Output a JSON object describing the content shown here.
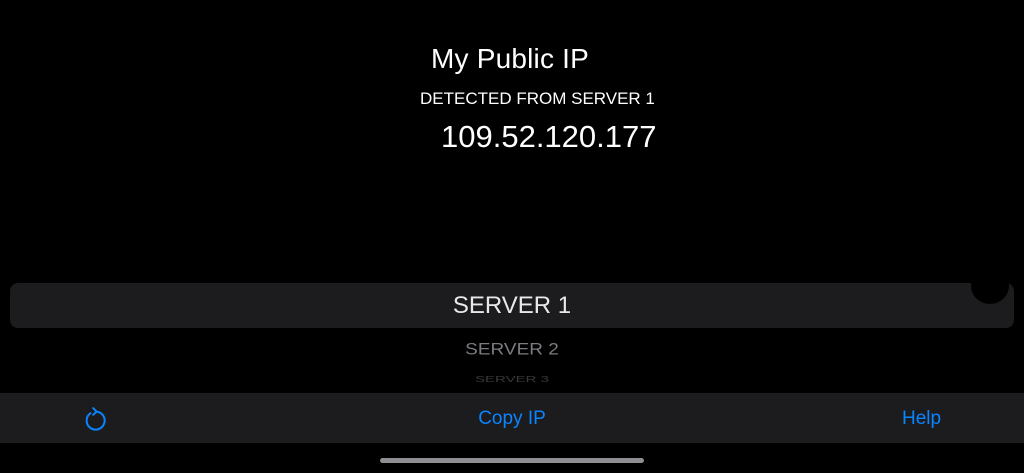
{
  "header": {
    "title": "My Public IP",
    "source_label": "DETECTED FROM SERVER 1",
    "ip_address": "109.52.120.177"
  },
  "server_picker": {
    "selected": "SERVER 1",
    "options": [
      "SERVER 1",
      "SERVER 2",
      "SERVER 3"
    ]
  },
  "toolbar": {
    "refresh_icon": "refresh-icon",
    "copy_label": "Copy IP",
    "help_label": "Help"
  },
  "colors": {
    "background": "#000000",
    "toolbar": "#1c1c1e",
    "picker_highlight": "#1c1c1e",
    "accent": "#0a84ff",
    "text": "#ffffff"
  }
}
